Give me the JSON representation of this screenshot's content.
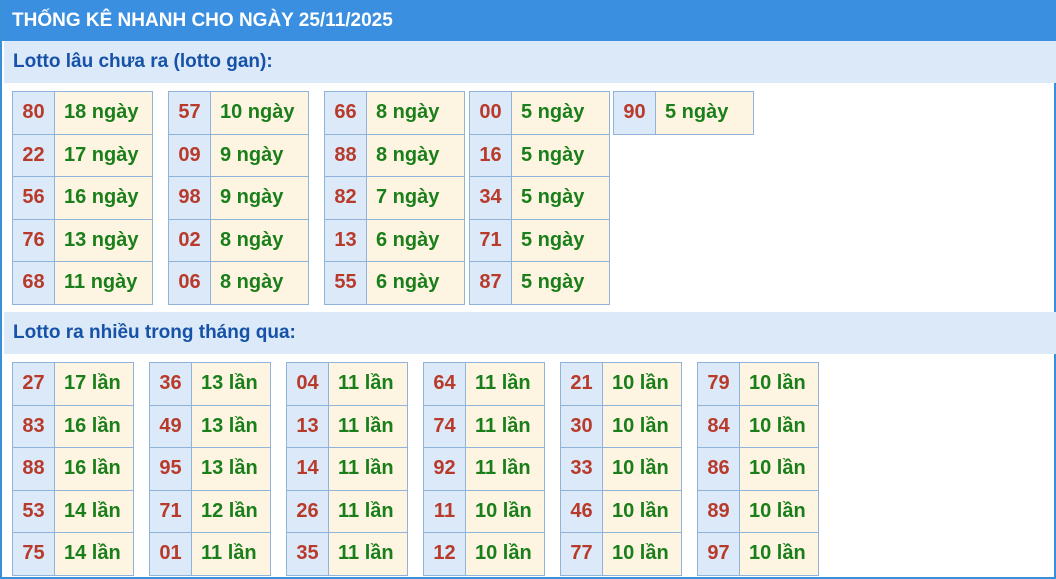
{
  "title": "THỐNG KÊ NHANH CHO NGÀY 25/11/2025",
  "gan_heading": "Lotto lâu chưa ra (lotto gan):",
  "gan_groups": [
    [
      [
        "80",
        "18 ngày"
      ],
      [
        "22",
        "17 ngày"
      ],
      [
        "56",
        "16 ngày"
      ],
      [
        "76",
        "13 ngày"
      ],
      [
        "68",
        "11 ngày"
      ]
    ],
    [
      [
        "57",
        "10 ngày"
      ],
      [
        "09",
        "9 ngày"
      ],
      [
        "98",
        "9 ngày"
      ],
      [
        "02",
        "8 ngày"
      ],
      [
        "06",
        "8 ngày"
      ]
    ],
    [
      [
        "66",
        "8 ngày"
      ],
      [
        "88",
        "8 ngày"
      ],
      [
        "82",
        "7 ngày"
      ],
      [
        "13",
        "6 ngày"
      ],
      [
        "55",
        "6 ngày"
      ]
    ],
    [
      [
        "00",
        "5 ngày"
      ],
      [
        "16",
        "5 ngày"
      ],
      [
        "34",
        "5 ngày"
      ],
      [
        "71",
        "5 ngày"
      ],
      [
        "87",
        "5 ngày"
      ]
    ],
    [
      [
        "90",
        "5 ngày"
      ]
    ]
  ],
  "frequent_heading": "Lotto ra nhiều trong tháng qua:",
  "frequent_groups": [
    [
      [
        "27",
        "17 lần"
      ],
      [
        "83",
        "16 lần"
      ],
      [
        "88",
        "16 lần"
      ],
      [
        "53",
        "14 lần"
      ],
      [
        "75",
        "14 lần"
      ]
    ],
    [
      [
        "36",
        "13 lần"
      ],
      [
        "49",
        "13 lần"
      ],
      [
        "95",
        "13 lần"
      ],
      [
        "71",
        "12 lần"
      ],
      [
        "01",
        "11 lần"
      ]
    ],
    [
      [
        "04",
        "11 lần"
      ],
      [
        "13",
        "11 lần"
      ],
      [
        "14",
        "11 lần"
      ],
      [
        "26",
        "11 lần"
      ],
      [
        "35",
        "11 lần"
      ]
    ],
    [
      [
        "64",
        "11 lần"
      ],
      [
        "74",
        "11 lần"
      ],
      [
        "92",
        "11 lần"
      ],
      [
        "11",
        "10 lần"
      ],
      [
        "12",
        "10 lần"
      ]
    ],
    [
      [
        "21",
        "10 lần"
      ],
      [
        "30",
        "10 lần"
      ],
      [
        "33",
        "10 lần"
      ],
      [
        "46",
        "10 lần"
      ],
      [
        "77",
        "10 lần"
      ]
    ],
    [
      [
        "79",
        "10 lần"
      ],
      [
        "84",
        "10 lần"
      ],
      [
        "86",
        "10 lần"
      ],
      [
        "89",
        "10 lần"
      ],
      [
        "97",
        "10 lần"
      ]
    ]
  ]
}
